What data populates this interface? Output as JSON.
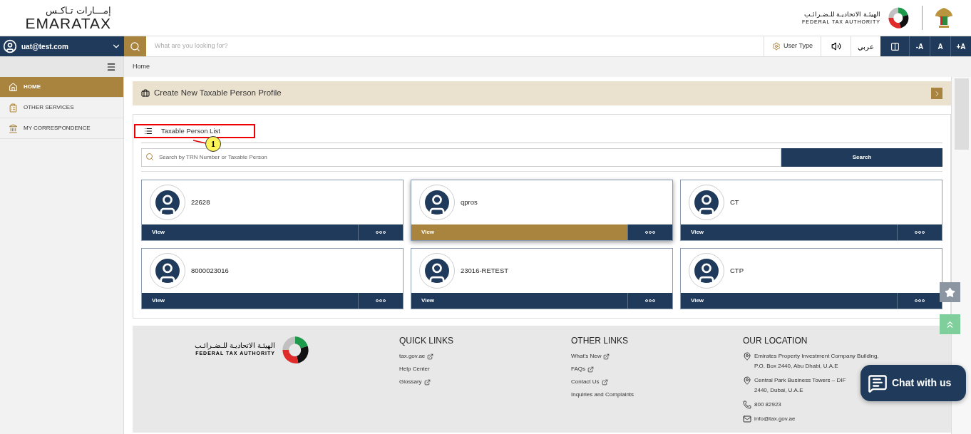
{
  "header": {
    "logo_arabic": "إمـــارات تـاكـس",
    "logo_latin": "EMARATAX",
    "authority_arabic": "الهيئـة الاتحاديـة للـضـرائـب",
    "authority_latin": "FEDERAL TAX AUTHORITY"
  },
  "topbar": {
    "user": "uat@test.com",
    "search_placeholder": "What are you looking for?",
    "user_type": "User Type",
    "language": "عربي",
    "font_buttons": [
      "-A",
      "A",
      "+A"
    ]
  },
  "sidebar": {
    "items": [
      {
        "label": "HOME",
        "selected": true
      },
      {
        "label": "OTHER SERVICES",
        "selected": false
      },
      {
        "label": "MY CORRESPONDENCE",
        "selected": false
      }
    ]
  },
  "breadcrumb": "Home",
  "create_banner": "Create New Taxable Person Profile",
  "list": {
    "title": "Taxable Person List",
    "callout": "1",
    "search_placeholder": "Search by TRN Number or Taxable Person",
    "search_button": "Search",
    "cards": [
      {
        "name": "22628",
        "action": "View",
        "selected": false
      },
      {
        "name": "qpros",
        "action": "View",
        "selected": true
      },
      {
        "name": "CT",
        "action": "View",
        "selected": false
      },
      {
        "name": "8000023016",
        "action": "View",
        "selected": false
      },
      {
        "name": "23016-RETEST",
        "action": "View",
        "selected": false
      },
      {
        "name": "CTP",
        "action": "View",
        "selected": false
      }
    ]
  },
  "footer": {
    "authority_arabic": "الهيئـة الاتحاديـة للـضـرائـب",
    "authority_latin": "FEDERAL TAX AUTHORITY",
    "quick_links": {
      "title": "QUICK LINKS",
      "links": [
        {
          "label": "tax.gov.ae",
          "external": true
        },
        {
          "label": "Help Center",
          "external": false
        },
        {
          "label": "Glossary",
          "external": true
        }
      ]
    },
    "other_links": {
      "title": "OTHER LINKS",
      "links": [
        {
          "label": "What's New",
          "external": true
        },
        {
          "label": "FAQs",
          "external": true
        },
        {
          "label": "Contact Us",
          "external": true
        },
        {
          "label": "Inquiries and Complaints",
          "external": false
        }
      ]
    },
    "location": {
      "title": "OUR LOCATION",
      "items": [
        {
          "kind": "pin",
          "lines": [
            "Emirates Property Investment Company Building,",
            "P.O. Box 2440, Abu Dhabi, U.A.E"
          ]
        },
        {
          "kind": "pin",
          "lines": [
            "Central Park Business Towers – DIF",
            "2440, Dubai, U.A.E"
          ]
        },
        {
          "kind": "phone",
          "lines": [
            "800 82923"
          ]
        },
        {
          "kind": "mail",
          "lines": [
            "info@tax.gov.ae"
          ]
        }
      ]
    }
  },
  "chat": "Chat with us"
}
